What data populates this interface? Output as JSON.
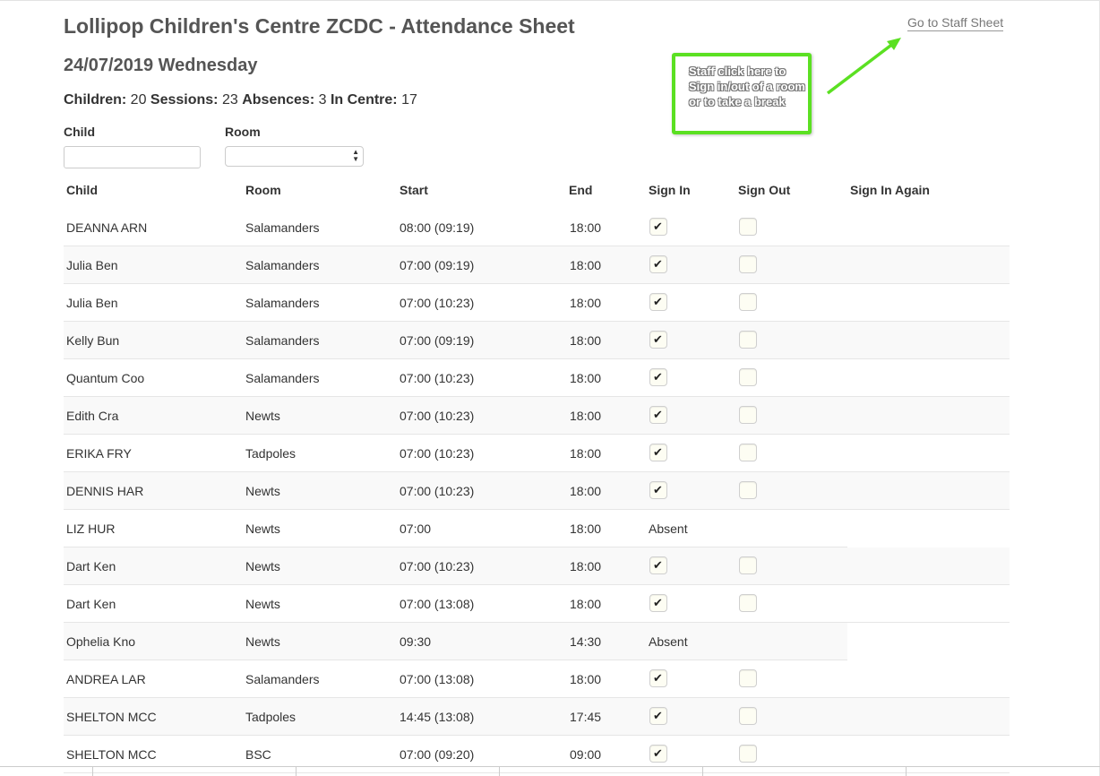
{
  "header": {
    "title": "Lollipop Children's Centre ZCDC - Attendance Sheet",
    "staff_link": "Go to Staff Sheet",
    "date": "24/07/2019 Wednesday"
  },
  "stats": {
    "children_label": "Children:",
    "children_value": "20",
    "sessions_label": "Sessions:",
    "sessions_value": "23",
    "absences_label": "Absences:",
    "absences_value": "3",
    "in_centre_label": "In Centre:",
    "in_centre_value": "17"
  },
  "filters": {
    "child_label": "Child",
    "child_value": "",
    "room_label": "Room",
    "room_value": ""
  },
  "callout": {
    "text": "Staff click here to Sign in/out of a room or to take a break",
    "border_color": "#5be022"
  },
  "table": {
    "headers": {
      "child": "Child",
      "room": "Room",
      "start": "Start",
      "end": "End",
      "sign_in": "Sign In",
      "sign_out": "Sign Out",
      "sign_in_again": "Sign In Again"
    },
    "rows": [
      {
        "child": "DEANNA ARN",
        "room": "Salamanders",
        "start": "08:00 (09:19)",
        "end": "18:00",
        "signed_in": true,
        "signed_out": false,
        "absent": false
      },
      {
        "child": "Julia Ben",
        "room": "Salamanders",
        "start": "07:00 (09:19)",
        "end": "18:00",
        "signed_in": true,
        "signed_out": false,
        "absent": false
      },
      {
        "child": "Julia Ben",
        "room": "Salamanders",
        "start": "07:00 (10:23)",
        "end": "18:00",
        "signed_in": true,
        "signed_out": false,
        "absent": false
      },
      {
        "child": "Kelly Bun",
        "room": "Salamanders",
        "start": "07:00 (09:19)",
        "end": "18:00",
        "signed_in": true,
        "signed_out": false,
        "absent": false
      },
      {
        "child": "Quantum Coo",
        "room": "Salamanders",
        "start": "07:00 (10:23)",
        "end": "18:00",
        "signed_in": true,
        "signed_out": false,
        "absent": false
      },
      {
        "child": "Edith Cra",
        "room": "Newts",
        "start": "07:00 (10:23)",
        "end": "18:00",
        "signed_in": true,
        "signed_out": false,
        "absent": false
      },
      {
        "child": "ERIKA FRY",
        "room": "Tadpoles",
        "start": "07:00 (10:23)",
        "end": "18:00",
        "signed_in": true,
        "signed_out": false,
        "absent": false
      },
      {
        "child": "DENNIS HAR",
        "room": "Newts",
        "start": "07:00 (10:23)",
        "end": "18:00",
        "signed_in": true,
        "signed_out": false,
        "absent": false
      },
      {
        "child": "LIZ HUR",
        "room": "Newts",
        "start": "07:00",
        "end": "18:00",
        "absent": true,
        "absent_label": "Absent"
      },
      {
        "child": "Dart Ken",
        "room": "Newts",
        "start": "07:00 (10:23)",
        "end": "18:00",
        "signed_in": true,
        "signed_out": false,
        "absent": false
      },
      {
        "child": "Dart Ken",
        "room": "Newts",
        "start": "07:00 (13:08)",
        "end": "18:00",
        "signed_in": true,
        "signed_out": false,
        "absent": false
      },
      {
        "child": "Ophelia Kno",
        "room": "Newts",
        "start": "09:30",
        "end": "14:30",
        "absent": true,
        "absent_label": "Absent"
      },
      {
        "child": "ANDREA LAR",
        "room": "Salamanders",
        "start": "07:00 (13:08)",
        "end": "18:00",
        "signed_in": true,
        "signed_out": false,
        "absent": false
      },
      {
        "child": "SHELTON MCC",
        "room": "Tadpoles",
        "start": "14:45 (13:08)",
        "end": "17:45",
        "signed_in": true,
        "signed_out": false,
        "absent": false
      },
      {
        "child": "SHELTON MCC",
        "room": "BSC",
        "start": "07:00 (09:20)",
        "end": "09:00",
        "signed_in": true,
        "signed_out": false,
        "absent": false
      }
    ]
  }
}
